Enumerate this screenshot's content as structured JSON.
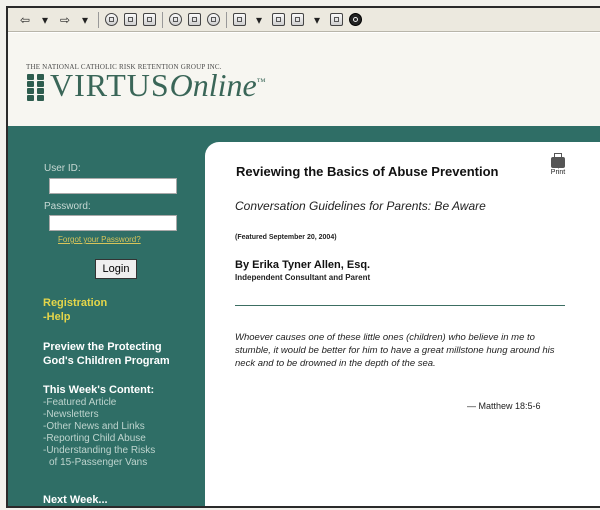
{
  "toolbar": {
    "back": "⇦",
    "dropdown": "▾",
    "forward": "⇨"
  },
  "header": {
    "org_name": "THE NATIONAL CATHOLIC RISK RETENTION GROUP INC.",
    "logo_main": "VIRTUS",
    "logo_script": "Online",
    "logo_tm": "™"
  },
  "sidebar": {
    "user_id_label": "User ID:",
    "user_id_value": "",
    "password_label": "Password:",
    "password_value": "",
    "forgot_password": "Forgot your Password?",
    "login_button": "Login",
    "registration": "Registration",
    "help": "-Help",
    "preview_line1": "Preview the Protecting",
    "preview_line2": "God's Children Program",
    "this_week": "This Week's Content:",
    "this_week_items": [
      "-Featured Article",
      "-Newsletters",
      "-Other News and Links",
      "-Reporting Child Abuse",
      "-Understanding the Risks",
      "of 15-Passenger Vans"
    ],
    "next_week": "Next Week..."
  },
  "article": {
    "title": "Reviewing the Basics of Abuse Prevention",
    "print_label": "Print",
    "subtitle": "Conversation Guidelines for Parents: Be Aware",
    "featured": "(Featured September 20, 2004)",
    "author": "By Erika Tyner Allen, Esq.",
    "author_role": "Independent Consultant and Parent",
    "quote": "Whoever causes one of these little ones (children) who believe in me to stumble, it would be better for him to have a great millstone hung around his neck and to be drowned in the depth of the sea.",
    "citation": "— Matthew 18:5-6"
  },
  "colors": {
    "brand_green": "#2f6e66",
    "logo_green": "#3a6658",
    "link_yellow": "#e5d64a"
  }
}
